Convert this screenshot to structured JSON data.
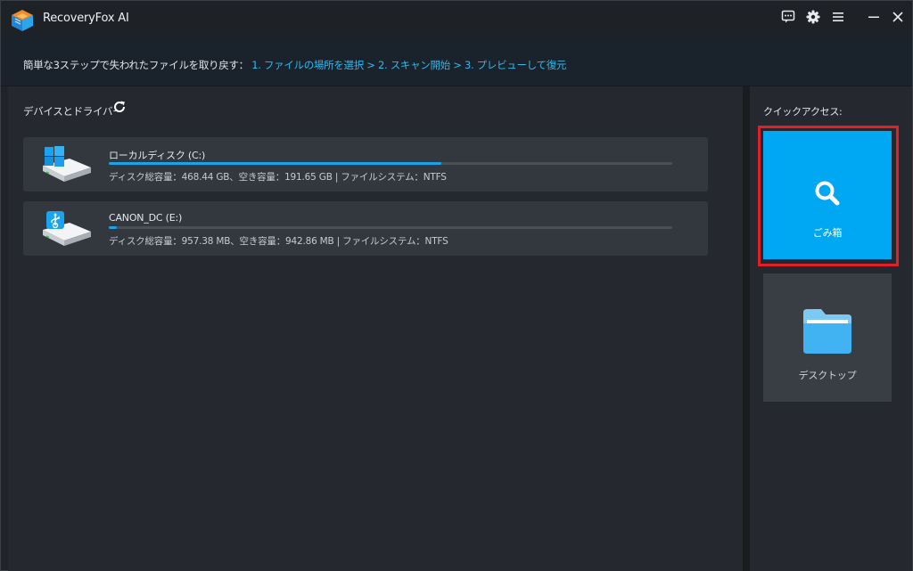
{
  "app": {
    "title": "RecoveryFox AI"
  },
  "titlebar": {
    "icons": [
      "feedback-icon",
      "settings-gear-icon",
      "menu-icon",
      "minimize-icon",
      "close-icon"
    ]
  },
  "infobar": {
    "prefix": "簡単な3ステップで失われたファイルを取り戻す：",
    "steps": "1. ファイルの場所を選択 > 2. スキャン開始 > 3. プレビューして復元"
  },
  "devices": {
    "title": "デバイスとドライバー",
    "drives": [
      {
        "name": "ローカルディスク (C:)",
        "info": "ディスク総容量：468.44 GB、空き容量：191.65 GB | ファイルシステム：NTFS",
        "usage_fraction": 0.59,
        "icon": "windows-drive-icon"
      },
      {
        "name": "CANON_DC (E:)",
        "info": "ディスク総容量：957.38 MB、空き容量：942.86 MB | ファイルシステム：NTFS",
        "usage_fraction": 0.015,
        "icon": "usb-drive-icon"
      }
    ]
  },
  "quick_access": {
    "title": "クイックアクセス:",
    "items": [
      {
        "label": "ごみ箱",
        "icon": "search-icon",
        "highlighted": true
      },
      {
        "label": "デスクトップ",
        "icon": "folder-icon",
        "highlighted": false
      }
    ]
  },
  "colors": {
    "accent": "#00a8f3",
    "steps_text": "#2fb8ee",
    "highlight_border": "#e01f26",
    "progress_fill": "#1aa3e6"
  }
}
